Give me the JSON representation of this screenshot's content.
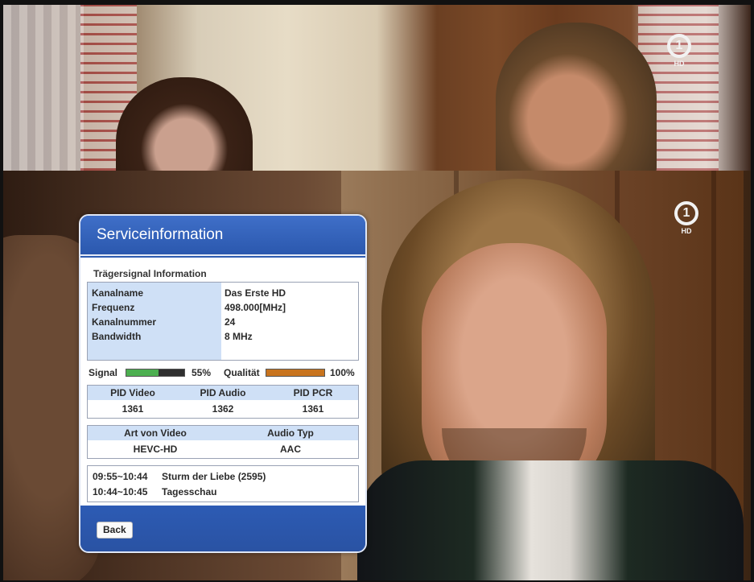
{
  "channel_logo": {
    "number": "1",
    "label": "HD"
  },
  "dialog": {
    "title": "Serviceinformation",
    "section_title": "Trägersignal Information",
    "carrier_info": [
      {
        "key": "Kanalname",
        "value": "Das Erste HD"
      },
      {
        "key": "Frequenz",
        "value": "498.000[MHz]"
      },
      {
        "key": "Kanalnummer",
        "value": "24"
      },
      {
        "key": "Bandwidth",
        "value": "8 MHz"
      }
    ],
    "signal": {
      "signal_label": "Signal",
      "signal_percent": "55%",
      "signal_level": 0.55,
      "signal_color": "#4caf50",
      "quality_label": "Qualität",
      "quality_percent": "100%",
      "quality_level": 1.0,
      "quality_color": "#c8741e"
    },
    "pid": {
      "headers": [
        "PID Video",
        "PID Audio",
        "PID PCR"
      ],
      "values": [
        "1361",
        "1362",
        "1361"
      ]
    },
    "stream_type": {
      "headers": [
        "Art von Video",
        "Audio Typ"
      ],
      "values": [
        "HEVC-HD",
        "AAC"
      ]
    },
    "epg": [
      {
        "time": "09:55~10:44",
        "title": "Sturm der Liebe (2595)"
      },
      {
        "time": "10:44~10:45",
        "title": "Tagesschau"
      }
    ],
    "back_label": "Back"
  }
}
